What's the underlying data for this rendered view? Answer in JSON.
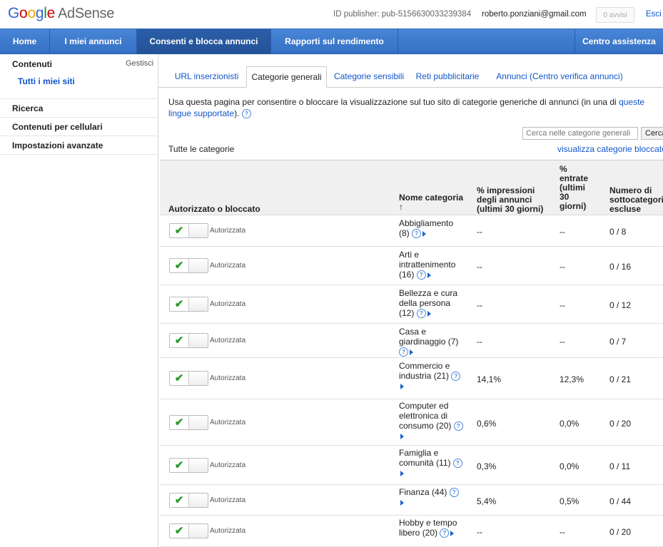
{
  "header": {
    "logo_text": "Google",
    "product": "AdSense",
    "publisher_id": "ID publisher: pub-5156630033239384",
    "email": "roberto.ponziani@gmail.com",
    "notifications": "0 avvisi",
    "logout": "Esci"
  },
  "nav": {
    "items": [
      {
        "label": "Home"
      },
      {
        "label": "I miei annunci"
      },
      {
        "label": "Consenti e blocca annunci"
      },
      {
        "label": "Rapporti sul rendimento"
      },
      {
        "label": "Centro assistenza"
      }
    ],
    "active_index": 2
  },
  "sidebar": {
    "section_title": "Contenuti",
    "manage_link": "Gestisci",
    "sub_item": "Tutti i miei siti",
    "items": [
      {
        "label": "Ricerca"
      },
      {
        "label": "Contenuti per cellulari"
      },
      {
        "label": "Impostazioni avanzate"
      }
    ]
  },
  "tabs": [
    {
      "label": "URL inserzionisti"
    },
    {
      "label": "Categorie generali"
    },
    {
      "label": "Categorie sensibili"
    },
    {
      "label": "Reti pubblicitarie"
    },
    {
      "label": "Annunci (Centro verifica annunci)"
    }
  ],
  "active_tab": 1,
  "description": {
    "text": "Usa questa pagina per consentire o bloccare la visualizzazione sul tuo sito di categorie generiche di annunci (in una di",
    "link": "queste lingue supportate",
    "end": ")."
  },
  "search": {
    "placeholder": "Cerca nelle categorie generali",
    "button": "Cerca"
  },
  "all_categories": "Tutte le categorie",
  "view_blocked": "visualizza categorie bloccate",
  "table": {
    "headers": {
      "status": "Autorizzato o bloccato",
      "name": "Nome categoria",
      "sort_indicator": "↑",
      "impressions": "% impressioni degli annunci (ultimi 30 giorni)",
      "earnings": "% entrate (ultimi 30 giorni)",
      "subcategories": "Numero di sottocategorie escluse"
    },
    "rows": [
      {
        "status": "Autorizzata",
        "name": "Abbigliamento",
        "count": "(8)",
        "impressions": "--",
        "earnings": "--",
        "subcategories": "0 / 8"
      },
      {
        "status": "Autorizzata",
        "name": "Arti e intrattenimento",
        "count": "(16)",
        "impressions": "--",
        "earnings": "--",
        "subcategories": "0 / 16"
      },
      {
        "status": "Autorizzata",
        "name": "Bellezza e cura della persona",
        "count": "(12)",
        "impressions": "--",
        "earnings": "--",
        "subcategories": "0 / 12"
      },
      {
        "status": "Autorizzata",
        "name": "Casa e giardinaggio",
        "count": "(7)",
        "impressions": "--",
        "earnings": "--",
        "subcategories": "0 / 7"
      },
      {
        "status": "Autorizzata",
        "name": "Commercio e industria",
        "count": "(21)",
        "impressions": "14,1%",
        "earnings": "12,3%",
        "subcategories": "0 / 21"
      },
      {
        "status": "Autorizzata",
        "name": "Computer ed elettronica di consumo",
        "count": "(20)",
        "impressions": "0,6%",
        "earnings": "0,0%",
        "subcategories": "0 / 20"
      },
      {
        "status": "Autorizzata",
        "name": "Famiglia e comunità",
        "count": "(11)",
        "impressions": "0,3%",
        "earnings": "0,0%",
        "subcategories": "0 / 11"
      },
      {
        "status": "Autorizzata",
        "name": "Finanza",
        "count": "(44)",
        "impressions": "5,4%",
        "earnings": "0,5%",
        "subcategories": "0 / 44"
      },
      {
        "status": "Autorizzata",
        "name": "Hobby e tempo libero",
        "count": "(20)",
        "impressions": "--",
        "earnings": "--",
        "subcategories": "0 / 20"
      }
    ]
  },
  "icons": {
    "help": "help-circle-icon",
    "expand": "triangle-right-icon",
    "allowed": "checkmark-icon"
  },
  "colors": {
    "nav_bg": "#3f7ccf",
    "nav_active": "#2858a0",
    "link": "#1155cc",
    "check": "#2a9a2a"
  }
}
